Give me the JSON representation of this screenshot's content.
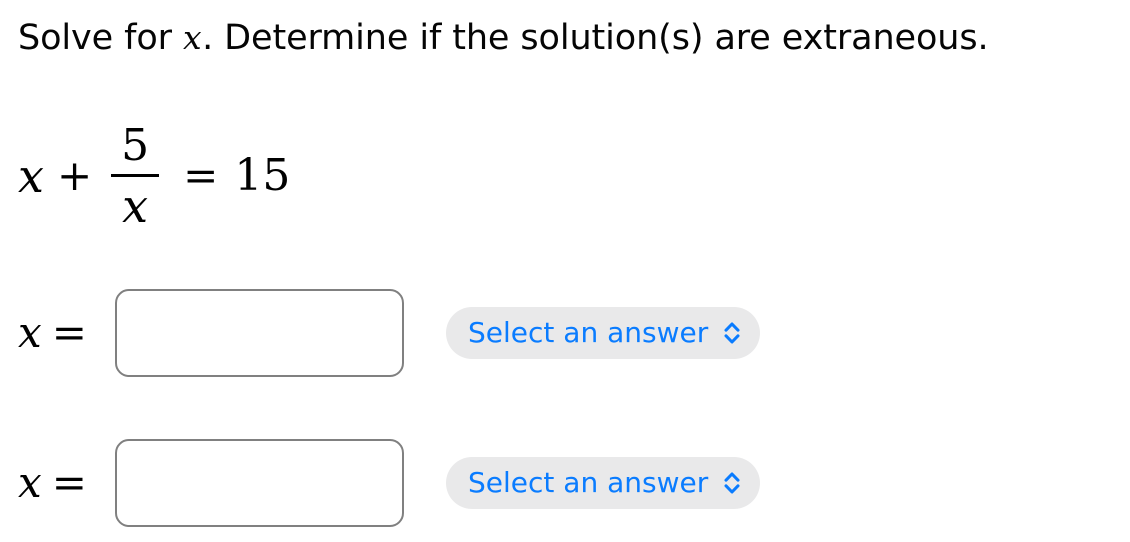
{
  "page": {
    "background": "#ffffff",
    "accent_blue": "#0a7cff",
    "pill_background": "#e9e9ea",
    "input_border": "#808080"
  },
  "prompt": {
    "text_before_var": "Solve for ",
    "variable": "x",
    "text_after_var": ". Determine if the solution(s) are extraneous."
  },
  "equation": {
    "lhs_variable": "x",
    "operator": "+",
    "fraction_numerator": "5",
    "fraction_denominator": "x",
    "equals": "=",
    "rhs": "15",
    "plain": "x + 5/x = 15"
  },
  "answers": [
    {
      "label_variable": "x",
      "label_equals": "=",
      "input_value": "",
      "input_placeholder": "",
      "select_label": "Select an answer",
      "select_icon": "chevron-up-down-icon"
    },
    {
      "label_variable": "x",
      "label_equals": "=",
      "input_value": "",
      "input_placeholder": "",
      "select_label": "Select an answer",
      "select_icon": "chevron-up-down-icon"
    }
  ]
}
